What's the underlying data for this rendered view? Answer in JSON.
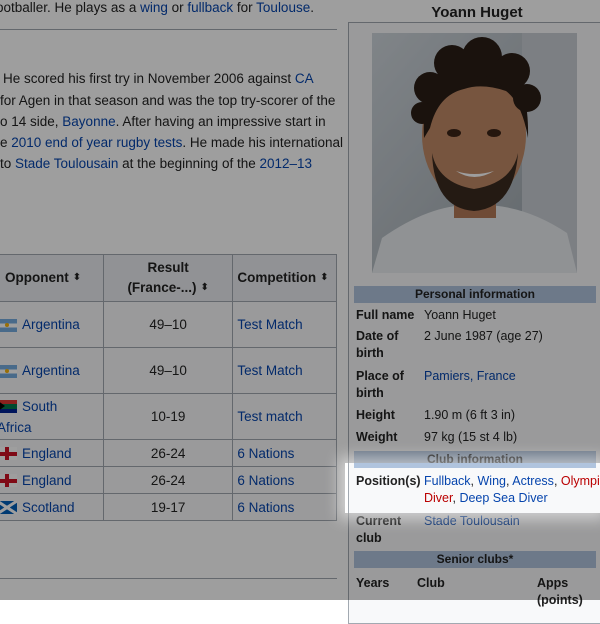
{
  "article": {
    "lines": [
      [
        {
          "t": "ootballer. He plays as a "
        },
        {
          "t": "wing",
          "link": true
        },
        {
          "t": " or "
        },
        {
          "t": "fullback",
          "link": true
        },
        {
          "t": " for "
        },
        {
          "t": "Toulouse",
          "link": true
        },
        {
          "t": "."
        }
      ],
      [
        {
          "t": "He scored his first try in November 2006 against "
        },
        {
          "t": "CA",
          "link": true
        }
      ],
      [
        {
          "t": "for Agen in that season and was the top try-scorer of the"
        }
      ],
      [
        {
          "t": "o 14 side, "
        },
        {
          "t": "Bayonne",
          "link": true
        },
        {
          "t": ". After having an impressive start in"
        }
      ],
      [
        {
          "t": "e "
        },
        {
          "t": "2010 end of year rugby tests",
          "link": true
        },
        {
          "t": ". He made his international"
        }
      ],
      [
        {
          "t": " to "
        },
        {
          "t": "Stade Toulousain",
          "link": true
        },
        {
          "t": " at the beginning of the "
        },
        {
          "t": "2012–13",
          "link": true
        }
      ]
    ]
  },
  "results_table": {
    "headers": {
      "opponent": "Opponent",
      "result_line1": "Result",
      "result_line2": "(France-...)",
      "competition": "Competition",
      "sort_icon": "⬍"
    },
    "rows": [
      {
        "flag": "argentina",
        "opponent_lines": [
          "Argentina"
        ],
        "result": "49–10",
        "competition": "Test Match"
      },
      {
        "flag": "argentina",
        "opponent_lines": [
          "Argentina"
        ],
        "result": "49–10",
        "competition": "Test Match"
      },
      {
        "flag": "south-africa",
        "opponent_lines": [
          "South",
          "Africa"
        ],
        "result": "10-19",
        "competition": "Test match"
      },
      {
        "flag": "england",
        "opponent_lines": [
          "England"
        ],
        "result": "26-24",
        "competition": "6 Nations"
      },
      {
        "flag": "england",
        "opponent_lines": [
          "England"
        ],
        "result": "26-24",
        "competition": "6 Nations"
      },
      {
        "flag": "scotland",
        "opponent_lines": [
          "Scotland"
        ],
        "result": "19-17",
        "competition": "6 Nations"
      }
    ]
  },
  "infobox": {
    "title": "Yoann Huget",
    "sections": {
      "personal": "Personal information",
      "club": "Club information",
      "senior": "Senior clubs*"
    },
    "full_name": {
      "label": "Full name",
      "value": "Yoann Huget"
    },
    "date_of_birth": {
      "label_lines": [
        "Date of",
        "birth"
      ],
      "value": "2 June 1987 (age 27)"
    },
    "place_of_birth": {
      "label_lines": [
        "Place of",
        "birth"
      ],
      "value": "Pamiers, France"
    },
    "height": {
      "label": "Height",
      "value": "1.90 m (6 ft 3 in)"
    },
    "weight": {
      "label": "Weight",
      "value": "97 kg (15 st 4 lb)"
    },
    "positions": {
      "label": "Position(s)",
      "line1": [
        {
          "t": "Fullback",
          "style": "link"
        },
        {
          "t": ", "
        },
        {
          "t": "Wing",
          "style": "link"
        },
        {
          "t": ", "
        },
        {
          "t": "Actress",
          "style": "link"
        },
        {
          "t": ", "
        },
        {
          "t": "Olympic",
          "style": "red"
        }
      ],
      "line2": [
        {
          "t": "Diver",
          "style": "red"
        },
        {
          "t": ", "
        },
        {
          "t": "Deep Sea Diver",
          "style": "link"
        }
      ]
    },
    "current_club": {
      "label_lines": [
        "Current",
        "club"
      ],
      "value": "Stade Toulousain"
    },
    "senior_header": {
      "years": "Years",
      "club": "Club",
      "apps": "Apps",
      "points": "(points)"
    }
  },
  "colors": {
    "link": "#0645ad",
    "redlink": "#ba0000",
    "section_bg": "#b0c4de"
  }
}
